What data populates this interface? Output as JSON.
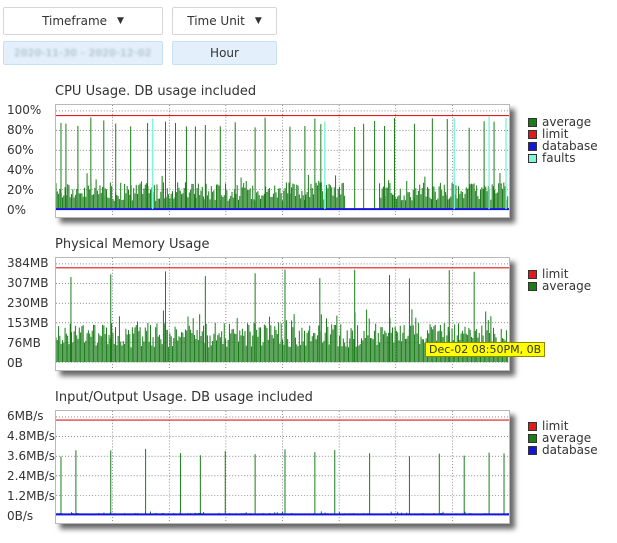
{
  "controls": {
    "timeframe_label": "Timeframe",
    "time_unit_label": "Time Unit",
    "date_range_value": "2020-11-30 - 2020-12-02",
    "time_unit_value": "Hour"
  },
  "tooltip": "Dec-02 08:50PM, 0B",
  "colors": {
    "average": "#1a7d1a",
    "limit": "#e31a1a",
    "database": "#1414e0",
    "faults": "#7ff5d9"
  },
  "chart_data": [
    {
      "type": "line",
      "title": "CPU Usage. DB usage included",
      "y_ticks": [
        "100%",
        "80%",
        "60%",
        "40%",
        "20%",
        "0%"
      ],
      "ylim": [
        0,
        105
      ],
      "grid": true,
      "legend": "right",
      "series": [
        {
          "name": "average",
          "color": "#1a7d1a",
          "baseline": 15,
          "noise": 10,
          "spikes": [
            5,
            10,
            22,
            35,
            48,
            60,
            75,
            92,
            110,
            120,
            131,
            140,
            150,
            165,
            180,
            200,
            210,
            235,
            250,
            260,
            266,
            300,
            309,
            320,
            330,
            340,
            360,
            378,
            393,
            415,
            430,
            440
          ],
          "spike_value": 98,
          "gaps": [
            [
              290,
              325
            ]
          ]
        },
        {
          "name": "limit",
          "color": "#e31a1a",
          "value": 100
        },
        {
          "name": "database",
          "color": "#1414e0",
          "value": 0
        },
        {
          "name": "faults",
          "color": "#7ff5d9",
          "spikes": [
            97,
            270,
            400,
            435,
            452
          ],
          "spike_value": 100
        }
      ]
    },
    {
      "type": "line",
      "title": "Physical Memory Usage",
      "y_ticks": [
        "384MB",
        "307MB",
        "230MB",
        "153MB",
        "76MB",
        "0B"
      ],
      "ylim": [
        0,
        400
      ],
      "grid": true,
      "legend": "right",
      "series": [
        {
          "name": "limit",
          "color": "#e31a1a",
          "value": 384
        },
        {
          "name": "average",
          "color": "#1a7d1a",
          "baseline": 90,
          "noise": 50,
          "spikes": [
            15,
            55,
            110,
            150,
            200,
            230,
            265,
            300,
            335,
            355,
            395,
            420
          ],
          "spike_value": 380,
          "gaps": []
        }
      ]
    },
    {
      "type": "line",
      "title": "Input/Output Usage. DB usage included",
      "y_ticks": [
        "6MB/s",
        "4.8MB/s",
        "3.6MB/s",
        "2.4MB/s",
        "1.2MB/s",
        "0B/s"
      ],
      "ylim": [
        0,
        6.2
      ],
      "grid": true,
      "legend": "right",
      "series": [
        {
          "name": "limit",
          "color": "#e31a1a",
          "value": 6
        },
        {
          "name": "average",
          "color": "#1a7d1a",
          "baseline": 0,
          "noise": 0.1,
          "spikes": [
            5,
            20,
            55,
            90,
            125,
            145,
            170,
            200,
            230,
            260,
            280,
            315,
            355,
            385,
            410,
            435,
            450
          ],
          "spike_value": 4.2,
          "gaps": []
        },
        {
          "name": "database",
          "color": "#1414e0",
          "value": 0.05
        }
      ]
    }
  ]
}
